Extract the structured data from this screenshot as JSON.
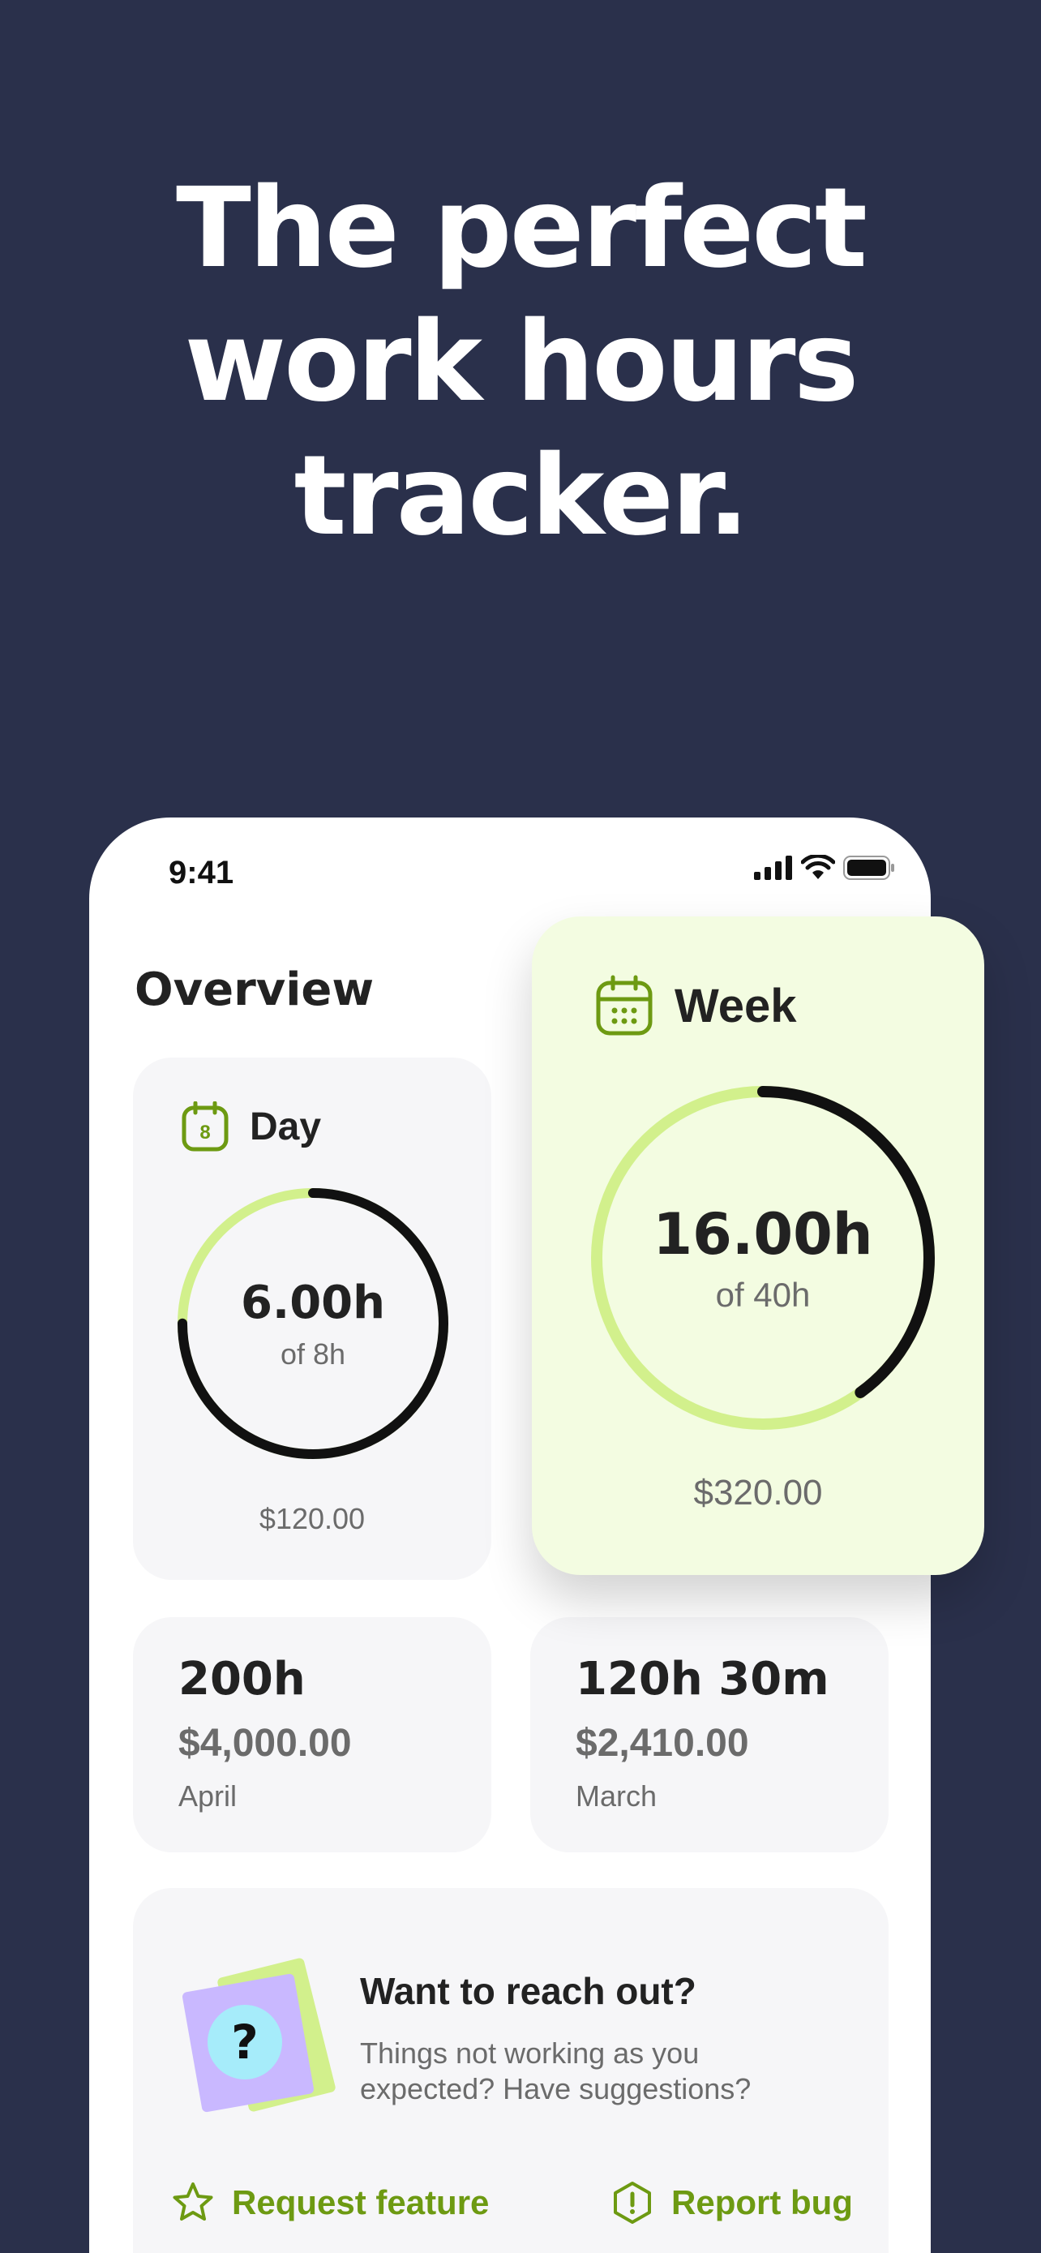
{
  "hero": {
    "line1": "The perfect",
    "line2": "work hours",
    "line3": "tracker."
  },
  "status": {
    "time": "9:41"
  },
  "overview": {
    "title": "Overview"
  },
  "day": {
    "label": "Day",
    "calendar_day": "8",
    "hours": "6.00h",
    "target": "of 8h",
    "money": "$120.00",
    "progress": 0.75
  },
  "week": {
    "label": "Week",
    "hours": "16.00h",
    "target": "of 40h",
    "money": "$320.00",
    "progress": 0.4
  },
  "stats": [
    {
      "hours": "200h",
      "money": "$4,000.00",
      "month": "April"
    },
    {
      "hours": "120h 30m",
      "money": "$2,410.00",
      "month": "March"
    }
  ],
  "reach": {
    "title": "Want to reach out?",
    "description": "Things not working as you expected? Have suggestions?",
    "question_mark": "?",
    "request_label": "Request feature",
    "report_label": "Report bug"
  },
  "colors": {
    "background": "#2a304b",
    "accent": "#d2f08c",
    "accent_dark": "#6d9a12",
    "ring": "#111111"
  }
}
